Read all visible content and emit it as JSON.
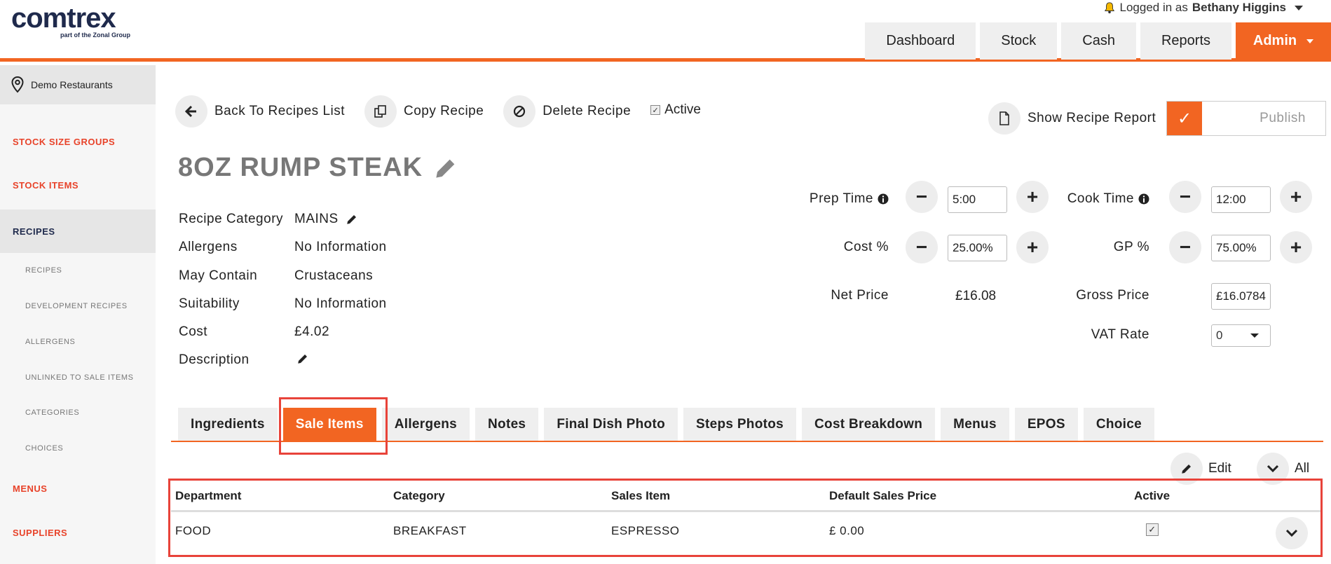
{
  "brand": {
    "name": "comtrex",
    "tagline": "part of the Zonal Group",
    "accent": "#f26522"
  },
  "user": {
    "prefix": "Logged in as",
    "name": "Bethany Higgins"
  },
  "nav": [
    "Dashboard",
    "Stock",
    "Cash",
    "Reports",
    "Admin"
  ],
  "sidebar": {
    "site": "Demo Restaurants",
    "items": [
      {
        "label": "STOCK SIZE GROUPS"
      },
      {
        "label": "STOCK ITEMS"
      },
      {
        "label": "RECIPES"
      },
      {
        "label": "RECIPES"
      },
      {
        "label": "DEVELOPMENT RECIPES"
      },
      {
        "label": "ALLERGENS"
      },
      {
        "label": "UNLINKED TO SALE ITEMS"
      },
      {
        "label": "CATEGORIES"
      },
      {
        "label": "CHOICES"
      },
      {
        "label": "MENUS"
      },
      {
        "label": "SUPPLIERS"
      }
    ]
  },
  "actions": {
    "back": "Back To Recipes List",
    "copy": "Copy Recipe",
    "delete": "Delete Recipe",
    "active": "Active",
    "report": "Show Recipe Report",
    "publish": "Publish"
  },
  "recipe": {
    "title": "8OZ RUMP STEAK",
    "category_label": "Recipe Category",
    "category": "MAINS",
    "allergens_label": "Allergens",
    "allergens": "No Information",
    "may_contain_label": "May Contain",
    "may_contain": "Crustaceans",
    "suitability_label": "Suitability",
    "suitability": "No Information",
    "cost_label": "Cost",
    "cost": "£4.02",
    "description_label": "Description"
  },
  "fields": {
    "prep_time_label": "Prep Time",
    "prep_time": "5:00",
    "cook_time_label": "Cook Time",
    "cook_time": "12:00",
    "cost_pct_label": "Cost %",
    "cost_pct": "25.00%",
    "gp_pct_label": "GP %",
    "gp_pct": "75.00%",
    "net_price_label": "Net Price",
    "net_price": "£16.08",
    "gross_price_label": "Gross Price",
    "gross_price": "£16.0784",
    "vat_rate_label": "VAT Rate",
    "vat_rate": "0"
  },
  "tabs": [
    "Ingredients",
    "Sale Items",
    "Allergens",
    "Notes",
    "Final Dish Photo",
    "Steps Photos",
    "Cost Breakdown",
    "Menus",
    "EPOS",
    "Choice"
  ],
  "table_tools": {
    "edit": "Edit",
    "all": "All"
  },
  "table": {
    "headers": [
      "Department",
      "Category",
      "Sales Item",
      "Default Sales Price",
      "Active"
    ],
    "rows": [
      {
        "department": "FOOD",
        "category": "BREAKFAST",
        "sales_item": "ESPRESSO",
        "price": "£ 0.00",
        "active": true
      }
    ]
  }
}
